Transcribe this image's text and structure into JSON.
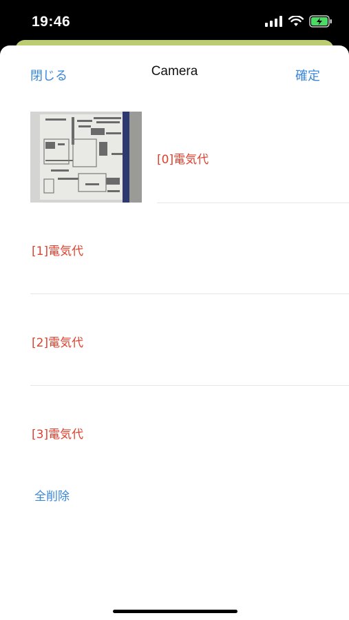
{
  "status_bar": {
    "time": "19:46",
    "icons": [
      "signal-icon",
      "wifi-icon",
      "battery-charging-icon"
    ]
  },
  "nav": {
    "close_label": "閉じる",
    "title": "Camera",
    "confirm_label": "確定"
  },
  "items": [
    {
      "label": "[0]電気代",
      "has_photo": true
    },
    {
      "label": "[1]電気代",
      "has_photo": false
    },
    {
      "label": "[2]電気代",
      "has_photo": false
    },
    {
      "label": "[3]電気代",
      "has_photo": false
    }
  ],
  "delete_all_label": "全削除",
  "colors": {
    "accent_blue": "#3a87d8",
    "label_red": "#e0412e",
    "behind_sheet_green": "#b9cc71",
    "battery_green": "#4cd964"
  }
}
